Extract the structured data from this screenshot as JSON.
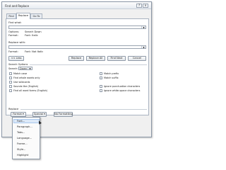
{
  "dialog": {
    "title": "Find and Replace",
    "help_glyph": "?",
    "close_glyph": "×"
  },
  "tabs": [
    {
      "label": "Find"
    },
    {
      "label": "Replace"
    },
    {
      "label": "Go To"
    }
  ],
  "find": {
    "label": "Find what:",
    "value": "",
    "options_label": "Options:",
    "options_value": "Search Down",
    "format_label": "Format:",
    "format_value": "Font: Italic"
  },
  "replace": {
    "label": "Replace with:",
    "value": "",
    "format_label": "Format:",
    "format_value": "Font: Not Italic"
  },
  "buttons": {
    "less": "<< Less",
    "replace": "Replace",
    "replace_all": "Replace All",
    "find_next": "Find Next",
    "cancel": "Cancel"
  },
  "search_options": {
    "heading": "Search Options",
    "search_label": "Search:",
    "search_value": "Down",
    "left": [
      "Match case",
      "Find whole words only",
      "Use wildcards",
      "Sounds like (English)",
      "Find all word forms (English)"
    ],
    "right": [
      "Match prefix",
      "Match suffix",
      "Ignore punctuation characters",
      "Ignore white-space characters"
    ]
  },
  "replace_section": {
    "heading": "Replace",
    "format_btn": "Format ▾",
    "special_btn": "Special ▾",
    "no_formatting_btn": "No Formatting"
  },
  "format_menu": {
    "items": [
      "Font...",
      "Paragraph...",
      "Tabs...",
      "Language...",
      "Frame...",
      "Style...",
      "Highlight"
    ],
    "highlighted_index": 0
  }
}
